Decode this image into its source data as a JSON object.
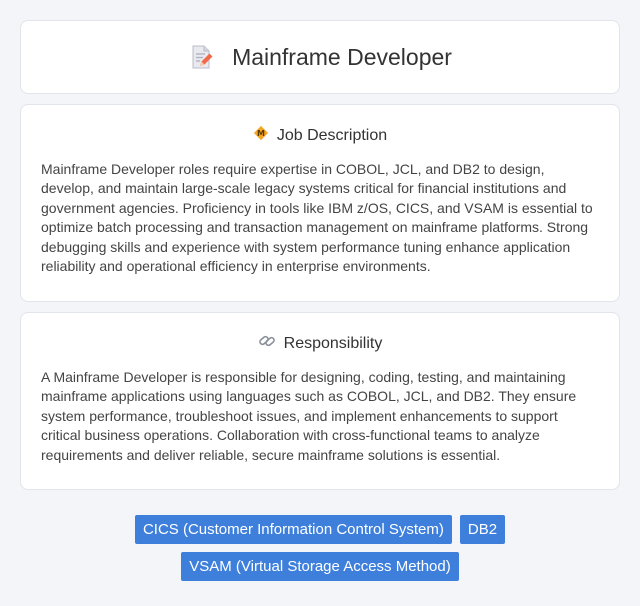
{
  "header": {
    "title": "Mainframe Developer",
    "icon": "document-edit-icon"
  },
  "job_description": {
    "heading": "Job Description",
    "icon": "diamond-badge-icon",
    "text": "Mainframe Developer roles require expertise in COBOL, JCL, and DB2 to design, develop, and maintain large-scale legacy systems critical for financial institutions and government agencies. Proficiency in tools like IBM z/OS, CICS, and VSAM is essential to optimize batch processing and transaction management on mainframe platforms. Strong debugging skills and experience with system performance tuning enhance application reliability and operational efficiency in enterprise environments."
  },
  "responsibility": {
    "heading": "Responsibility",
    "icon": "link-icon",
    "text": "A Mainframe Developer is responsible for designing, coding, testing, and maintaining mainframe applications using languages such as COBOL, JCL, and DB2. They ensure system performance, troubleshoot issues, and implement enhancements to support critical business operations. Collaboration with cross-functional teams to analyze requirements and deliver reliable, secure mainframe solutions is essential."
  },
  "tags": [
    {
      "label": "CICS (Customer Information Control System)"
    },
    {
      "label": "DB2"
    },
    {
      "label": "VSAM (Virtual Storage Access Method)"
    }
  ],
  "colors": {
    "tag_background": "#3d7fdb",
    "page_background": "#f3f5f9"
  }
}
